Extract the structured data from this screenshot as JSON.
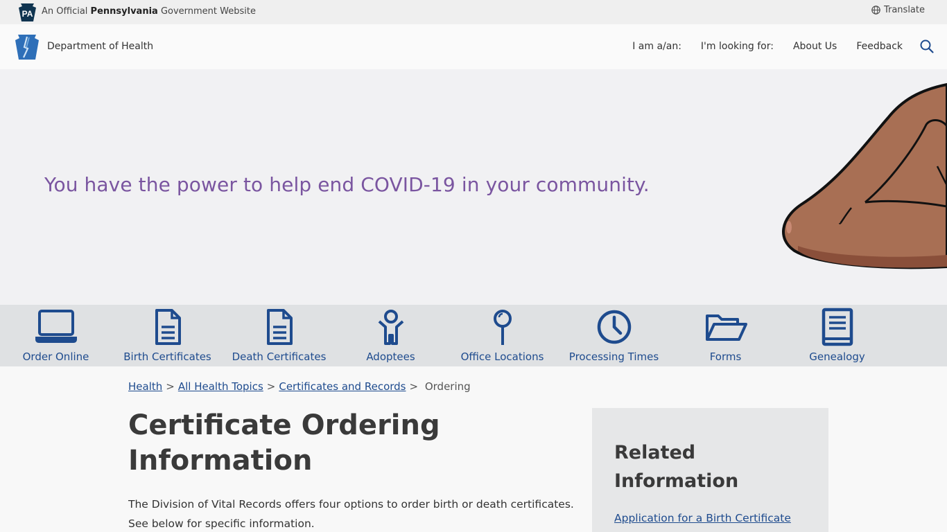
{
  "topbar": {
    "badge_text": "PA",
    "official_prefix": "An Official ",
    "official_state": "Pennsylvania",
    "official_suffix": " Government Website",
    "translate_label": "Translate"
  },
  "header": {
    "department": "Department of Health",
    "nav": [
      "I am a/an:",
      "I'm looking for:",
      "About Us",
      "Feedback"
    ],
    "search_icon": "search-icon"
  },
  "hero": {
    "headline": "You have the power to help end COVID-19 in your community.",
    "headline_color": "#7a55a0"
  },
  "quicklinks": [
    {
      "label": "Order Online",
      "icon": "laptop-icon"
    },
    {
      "label": "Birth Certificates",
      "icon": "document-icon"
    },
    {
      "label": "Death Certificates",
      "icon": "document-icon"
    },
    {
      "label": "Adoptees",
      "icon": "person-icon"
    },
    {
      "label": "Office Locations",
      "icon": "map-pin-icon"
    },
    {
      "label": "Processing Times",
      "icon": "clock-icon"
    },
    {
      "label": "Forms",
      "icon": "folder-open-icon"
    },
    {
      "label": "Genealogy",
      "icon": "book-icon"
    }
  ],
  "breadcrumb": {
    "items": [
      "Health",
      "All Health Topics",
      "Certificates and Records"
    ],
    "current": "Ordering"
  },
  "main": {
    "title": "Certificate Ordering Information",
    "intro": "The Division of Vital Records offers four options to order birth or death certificates. See below for specific information."
  },
  "sidebar": {
    "title": "Related Information",
    "links": [
      "Application for a Birth Certificate"
    ]
  },
  "colors": {
    "link_blue": "#1e4b8e",
    "icon_blue": "#1e4b8e"
  }
}
